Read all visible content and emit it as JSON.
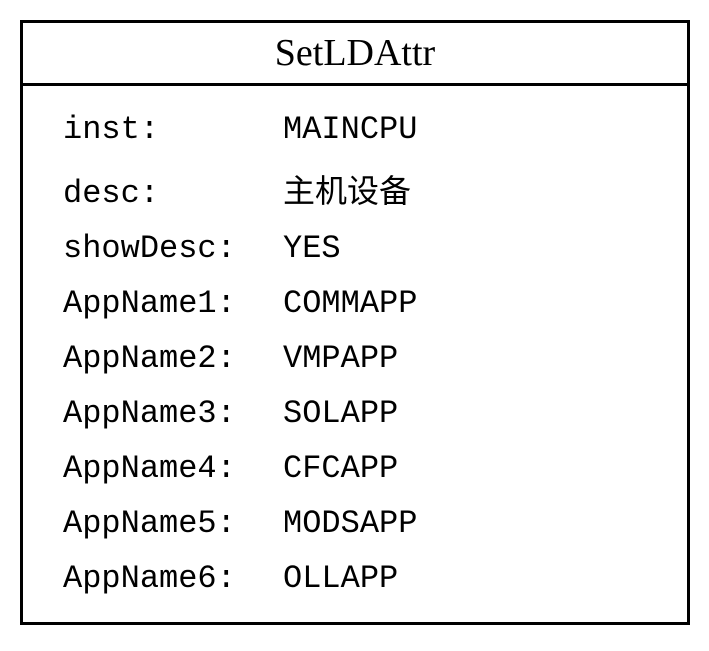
{
  "title": "SetLDAttr",
  "rows": [
    {
      "label": "inst:",
      "value": "MAINCPU"
    },
    {
      "label": "desc:",
      "value": "主机设备",
      "cjk": true
    },
    {
      "label": "showDesc:",
      "value": "YES"
    },
    {
      "label": "AppName1:",
      "value": "COMMAPP"
    },
    {
      "label": "AppName2:",
      "value": "VMPAPP"
    },
    {
      "label": "AppName3:",
      "value": "SOLAPP"
    },
    {
      "label": "AppName4:",
      "value": "CFCAPP"
    },
    {
      "label": "AppName5:",
      "value": "MODSAPP"
    },
    {
      "label": "AppName6:",
      "value": "OLLAPP"
    }
  ]
}
